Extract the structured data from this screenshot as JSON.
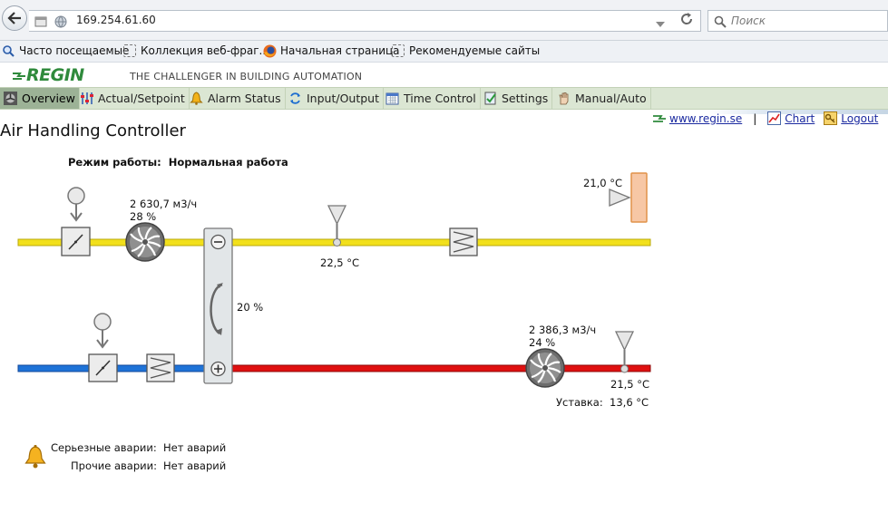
{
  "browser": {
    "address": "169.254.61.60",
    "search_placeholder": "Поиск",
    "bookmarks": [
      {
        "label": "Часто посещаемые"
      },
      {
        "label": "Коллекция веб-фраг..."
      },
      {
        "label": "Начальная страница"
      },
      {
        "label": "Рекомендуемые сайты"
      }
    ]
  },
  "header": {
    "logo": "REGIN",
    "tagline": "THE CHALLENGER IN BUILDING AUTOMATION"
  },
  "nav": [
    {
      "label": "Overview",
      "icon": "fan-icon"
    },
    {
      "label": "Actual/Setpoint",
      "icon": "sliders-icon"
    },
    {
      "label": "Alarm Status",
      "icon": "bell-icon"
    },
    {
      "label": "Input/Output",
      "icon": "arrows-icon"
    },
    {
      "label": "Time Control",
      "icon": "calendar-icon"
    },
    {
      "label": "Settings",
      "icon": "settings-icon"
    },
    {
      "label": "Manual/Auto",
      "icon": "hand-icon"
    }
  ],
  "links": {
    "site": "www.regin.se",
    "separator": "|",
    "chart": "Chart",
    "logout": "Logout"
  },
  "page": {
    "title": "Air Handling Controller",
    "mode_label": "Режим работы:",
    "mode_value": "Нормальная работа"
  },
  "diagram": {
    "supply_fan_flow": "2 630,7 м3/ч",
    "supply_fan_pct": "28 %",
    "supply_temp": "22,5 °C",
    "room_temp": "21,0 °C",
    "exchanger_pct": "20 %",
    "exhaust_fan_flow": "2 386,3 м3/ч",
    "exhaust_fan_pct": "24 %",
    "extract_temp": "21,5 °C",
    "setpoint_label": "Уставка:",
    "setpoint_value": "13,6 °C",
    "colors": {
      "supply": "#f2e01b",
      "extract": "#e01010",
      "outdoor": "#1e73d8"
    }
  },
  "alarms": {
    "serious_label": "Серьезные аварии:",
    "serious_value": "Нет аварий",
    "other_label": "Прочие аварии:",
    "other_value": "Нет аварий"
  }
}
